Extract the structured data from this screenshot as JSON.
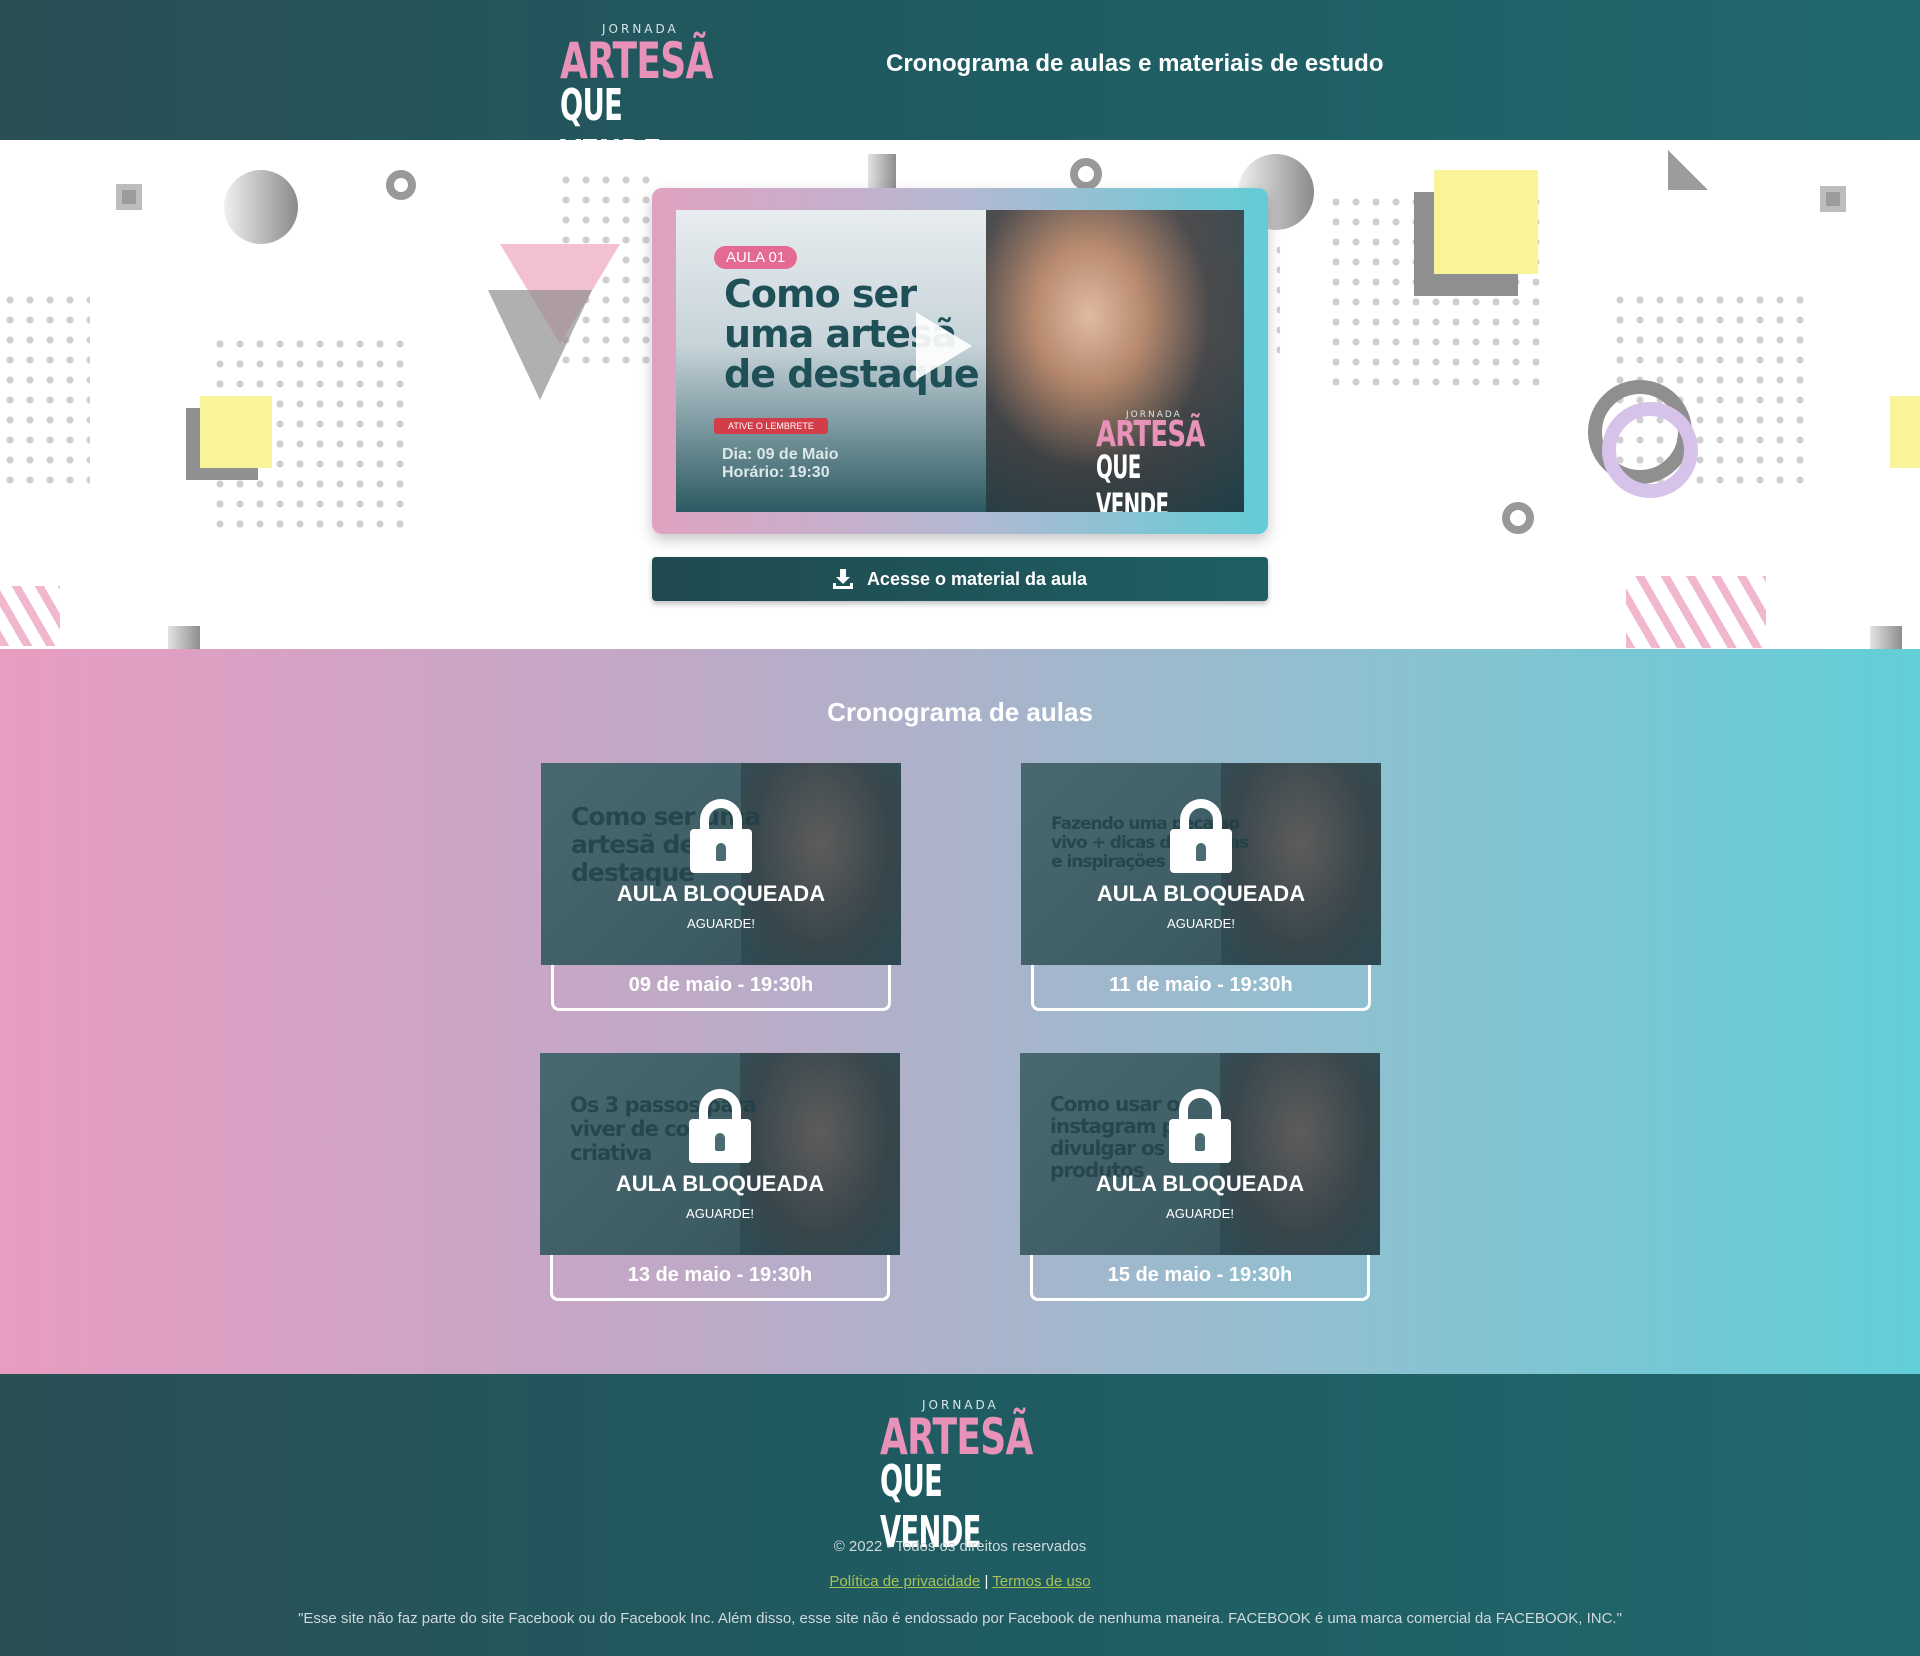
{
  "header": {
    "logo": {
      "small": "JORNADA",
      "line1": "ARTESÃ",
      "line2": "QUE VENDE"
    },
    "title": "Cronograma de aulas e materiais de estudo"
  },
  "hero": {
    "video": {
      "badge": "AULA 01",
      "title": "Como ser uma artesã de destaque",
      "reminder": "ATIVE O LEMBRETE",
      "date": "Dia: 09 de Maio",
      "time": "Horário: 19:30",
      "logo": {
        "small": "JORNADA",
        "line1": "ARTESÃ",
        "line2": "QUE VENDE"
      }
    },
    "material_button": "Acesse o material da aula"
  },
  "schedule": {
    "title": "Cronograma de aulas",
    "cards": [
      {
        "thumb_title": "Como ser uma artesã de destaque",
        "status": "AULA BLOQUEADA",
        "wait": "AGUARDE!",
        "date": "09 de maio - 19:30h"
      },
      {
        "thumb_title": "Fazendo uma peça ao vivo + dicas de vendas e inspirações",
        "status": "AULA BLOQUEADA",
        "wait": "AGUARDE!",
        "date": "11 de maio - 19:30h"
      },
      {
        "thumb_title": "Os 3 passos para viver de costura criativa",
        "status": "AULA BLOQUEADA",
        "wait": "AGUARDE!",
        "date": "13 de maio - 19:30h"
      },
      {
        "thumb_title": "Como usar o instagram para divulgar os seus produtos",
        "status": "AULA BLOQUEADA",
        "wait": "AGUARDE!",
        "date": "15 de maio - 19:30h"
      }
    ]
  },
  "footer": {
    "logo": {
      "small": "JORNADA",
      "line1": "ARTESÃ",
      "line2": "QUE VENDE"
    },
    "copyright": "© 2022 - Todos os direitos reservados",
    "privacy_link": "Política de privacidade",
    "separator": "|",
    "terms_link": "Termos de uso",
    "disclaimer": "\"Esse site não faz parte do site Facebook ou do Facebook Inc. Além disso, esse site não é endossado por Facebook de nenhuma maneira. FACEBOOK é uma marca comercial da FACEBOOK, INC.\""
  },
  "colors": {
    "header_bg": "#1f5a60",
    "accent_pink": "#e892b9",
    "accent_cyan": "#61ced8",
    "link_green": "#a9c255"
  }
}
